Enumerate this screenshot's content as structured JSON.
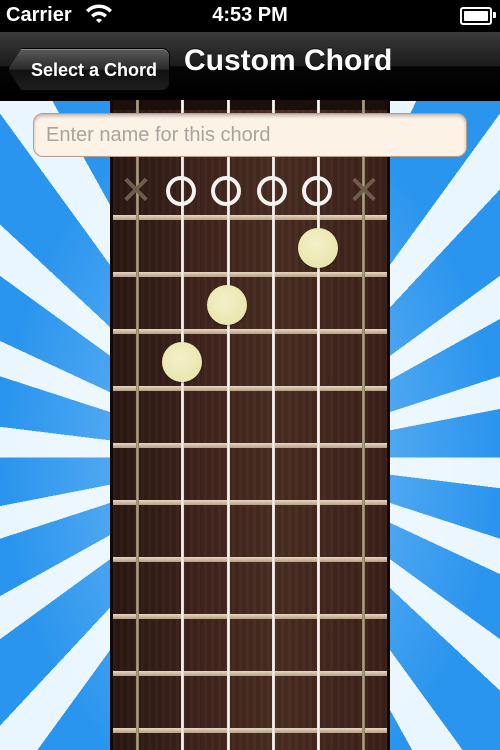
{
  "status_bar": {
    "carrier": "Carrier",
    "time": "4:53 PM"
  },
  "nav": {
    "back_label": "Select a Chord",
    "title": "Custom Chord"
  },
  "chord_name": {
    "value": "",
    "placeholder": "Enter name for this chord"
  },
  "strings": [
    {
      "id": "string-6",
      "state": "muted"
    },
    {
      "id": "string-5",
      "state": "open"
    },
    {
      "id": "string-4",
      "state": "open"
    },
    {
      "id": "string-3",
      "state": "open"
    },
    {
      "id": "string-2",
      "state": "open"
    },
    {
      "id": "string-1",
      "state": "muted"
    }
  ],
  "fingerings": [
    {
      "string": 2,
      "fret": 3
    },
    {
      "string": 3,
      "fret": 2
    },
    {
      "string": 5,
      "fret": 1
    }
  ],
  "colors": {
    "fretboard": "#3e241c",
    "finger_dot": "#ebe7b3",
    "background": "#2e9bf0"
  },
  "icons": {
    "wifi": "wifi-icon",
    "battery": "battery-icon",
    "muted": "x-marker-icon",
    "open": "open-circle-icon"
  }
}
